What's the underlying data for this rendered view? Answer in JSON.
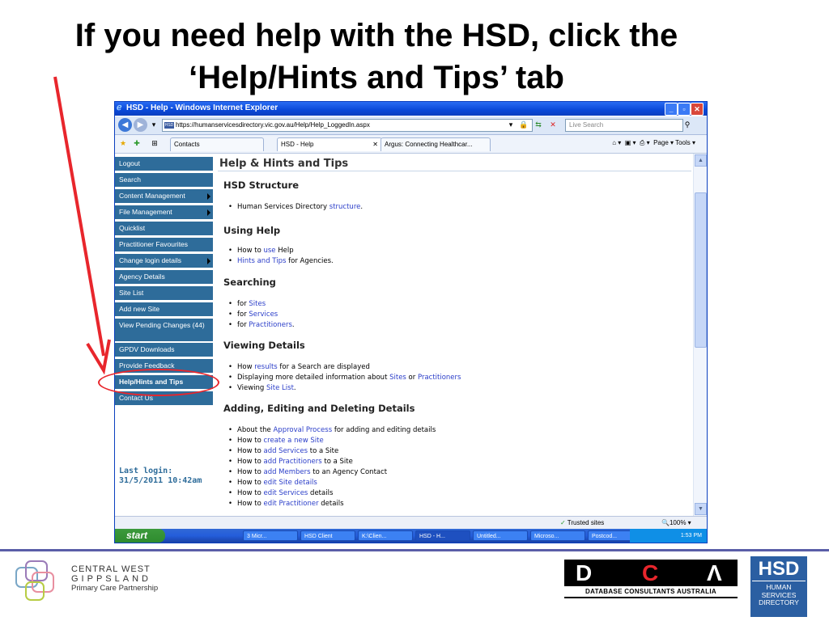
{
  "slide": {
    "title_line1": "If you need help with the HSD, click the",
    "title_line2": "‘Help/Hints and Tips’ tab"
  },
  "colors": {
    "accent_red": "#e8262c",
    "sidebar_blue": "#2e6c9a",
    "link_blue": "#2b3ec9"
  },
  "window": {
    "title": "HSD - Help - Windows Internet Explorer",
    "address": "https://humanservicesdirectory.vic.gov.au/Help/Help_LoggedIn.aspx",
    "search_placeholder": "Live Search",
    "tabs": [
      {
        "label": "Contacts"
      },
      {
        "label": "HSD - Help",
        "active": true
      },
      {
        "label": "Argus: Connecting Healthcar..."
      }
    ],
    "command_bar": "Page ▾   Tools ▾",
    "status": {
      "trusted": "Trusted sites",
      "zoom": "100%"
    }
  },
  "sidebar": {
    "items": [
      {
        "label": "Logout"
      },
      {
        "label": "Search"
      },
      {
        "label": "Content Management",
        "submenu": true
      },
      {
        "label": "File Management",
        "submenu": true
      },
      {
        "label": "Quicklist"
      },
      {
        "label": "Practitioner Favourites"
      },
      {
        "label": "Change login details",
        "submenu": true
      },
      {
        "label": "Agency Details"
      },
      {
        "label": "Site List"
      },
      {
        "label": "Add new Site"
      },
      {
        "label": "View Pending Changes (44)"
      },
      {
        "label": "GPDV Downloads"
      },
      {
        "label": "Provide Feedback"
      },
      {
        "label": "Help/Hints and Tips"
      },
      {
        "label": "Contact Us"
      }
    ],
    "last_login_label": "Last login:",
    "last_login_value": "31/5/2011 10:42am"
  },
  "main": {
    "heading": "Help & Hints and Tips",
    "sections": [
      {
        "title": "HSD Structure",
        "items": [
          {
            "pre": "Human Services Directory ",
            "link": "structure",
            "post": "."
          }
        ]
      },
      {
        "title": "Using Help",
        "items": [
          {
            "pre": "How to ",
            "link": "use",
            "post": " Help"
          },
          {
            "pre": "",
            "link": "Hints and Tips",
            "post": " for Agencies."
          }
        ]
      },
      {
        "title": "Searching",
        "items": [
          {
            "pre": "for ",
            "link": "Sites",
            "post": ""
          },
          {
            "pre": "for ",
            "link": "Services",
            "post": ""
          },
          {
            "pre": "for ",
            "link": "Practitioners",
            "post": "."
          }
        ]
      },
      {
        "title": "Viewing Details",
        "items": [
          {
            "pre": "How ",
            "link": "results",
            "post": " for a Search are displayed"
          },
          {
            "pre": "Displaying more detailed information about ",
            "link": "Sites",
            "post": " or ",
            "link2": "Practitioners"
          },
          {
            "pre": "Viewing ",
            "link": "Site List",
            "post": "."
          }
        ]
      },
      {
        "title": "Adding, Editing and Deleting Details",
        "items": [
          {
            "pre": "About the ",
            "link": "Approval Process",
            "post": " for adding and editing details"
          },
          {
            "pre": "How to ",
            "link": "create a new Site",
            "post": ""
          },
          {
            "pre": "How to ",
            "link": "add Services",
            "post": " to a Site"
          },
          {
            "pre": "How to ",
            "link": "add Practitioners",
            "post": " to a Site"
          },
          {
            "pre": "How to ",
            "link": "add Members",
            "post": " to an Agency Contact"
          },
          {
            "pre": "How to ",
            "link": "edit Site details",
            "post": ""
          },
          {
            "pre": "How to ",
            "link": "edit Services",
            "post": " details"
          },
          {
            "pre": "How to ",
            "link": "edit Practitioner",
            "post": " details"
          }
        ]
      }
    ]
  },
  "taskbar": {
    "start": "start",
    "buttons": [
      "3 Micr...",
      "HSD Client",
      "K:\\Clien...",
      "HSD - H...",
      "Untitled...",
      "Microso...",
      "Postcod..."
    ],
    "clock": "1:53 PM"
  },
  "footer": {
    "cwg": {
      "line1": "CENTRAL WEST",
      "line2": "GIPPSLAND",
      "line3": "Primary Care Partnership"
    },
    "dca": {
      "letters": "DCA",
      "subtitle": "DATABASE CONSULTANTS AUSTRALIA"
    },
    "hsd": {
      "big": "HSD",
      "line1": "HUMAN",
      "line2": "SERVICES",
      "line3": "DIRECTORY"
    }
  }
}
